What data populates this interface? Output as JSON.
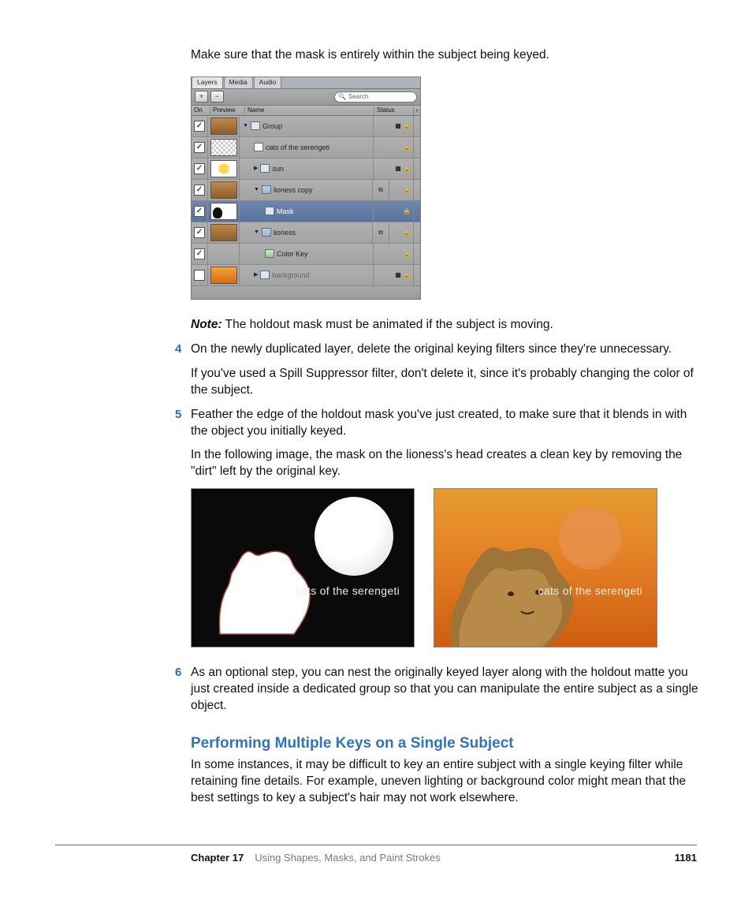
{
  "intro_text": "Make sure that the mask is entirely within the subject being keyed.",
  "panel": {
    "tabs": [
      "Layers",
      "Media",
      "Audio"
    ],
    "btn_add": "+",
    "btn_remove": "−",
    "search_placeholder": "Search",
    "headers": {
      "on": "On",
      "preview": "Preview",
      "name": "Name",
      "status": "Status",
      "end": "›"
    },
    "rows": {
      "group": {
        "disc": "▼",
        "label": "Group"
      },
      "title_text": {
        "label": "cats of the serengeti"
      },
      "sun": {
        "disc": "▶",
        "label": "sun"
      },
      "lioness_copy": {
        "disc": "▼",
        "label": "lioness copy"
      },
      "mask": {
        "label": "Mask"
      },
      "lioness": {
        "disc": "▼",
        "label": "lioness"
      },
      "color_key": {
        "label": "Color Key"
      },
      "background": {
        "disc": "▶",
        "label": "background"
      }
    },
    "check": "✓",
    "icon_stack": "▦",
    "icon_lock": "🔒",
    "icon_link": "⧉"
  },
  "note_label": "Note:",
  "note_text": " The holdout mask must be animated if the subject is moving.",
  "steps": {
    "s4": {
      "num": "4",
      "p1": "On the newly duplicated layer, delete the original keying filters since they're unnecessary.",
      "p2": "If you've used a Spill Suppressor filter, don't delete it, since it's probably changing the color of the subject."
    },
    "s5": {
      "num": "5",
      "p1": "Feather the edge of the holdout mask you've just created, to make sure that it blends in with the object you initially keyed.",
      "p2": "In the following image, the mask on the lioness's head creates a clean key by removing the \"dirt\" left by the original key."
    },
    "s6": {
      "num": "6",
      "p1": "As an optional step, you can nest the originally keyed layer along with the holdout matte you just created inside a dedicated group so that you can manipulate the entire subject as a single object."
    }
  },
  "result_caption": "cats of the serengeti",
  "section_heading": "Performing Multiple Keys on a Single Subject",
  "section_body": "In some instances, it may be difficult to key an entire subject with a single keying filter while retaining fine details. For example, uneven lighting or background color might mean that the best settings to key a subject's hair may not work elsewhere.",
  "footer": {
    "chapter": "Chapter 17",
    "title": "Using Shapes, Masks, and Paint Strokes",
    "page": "1181"
  }
}
